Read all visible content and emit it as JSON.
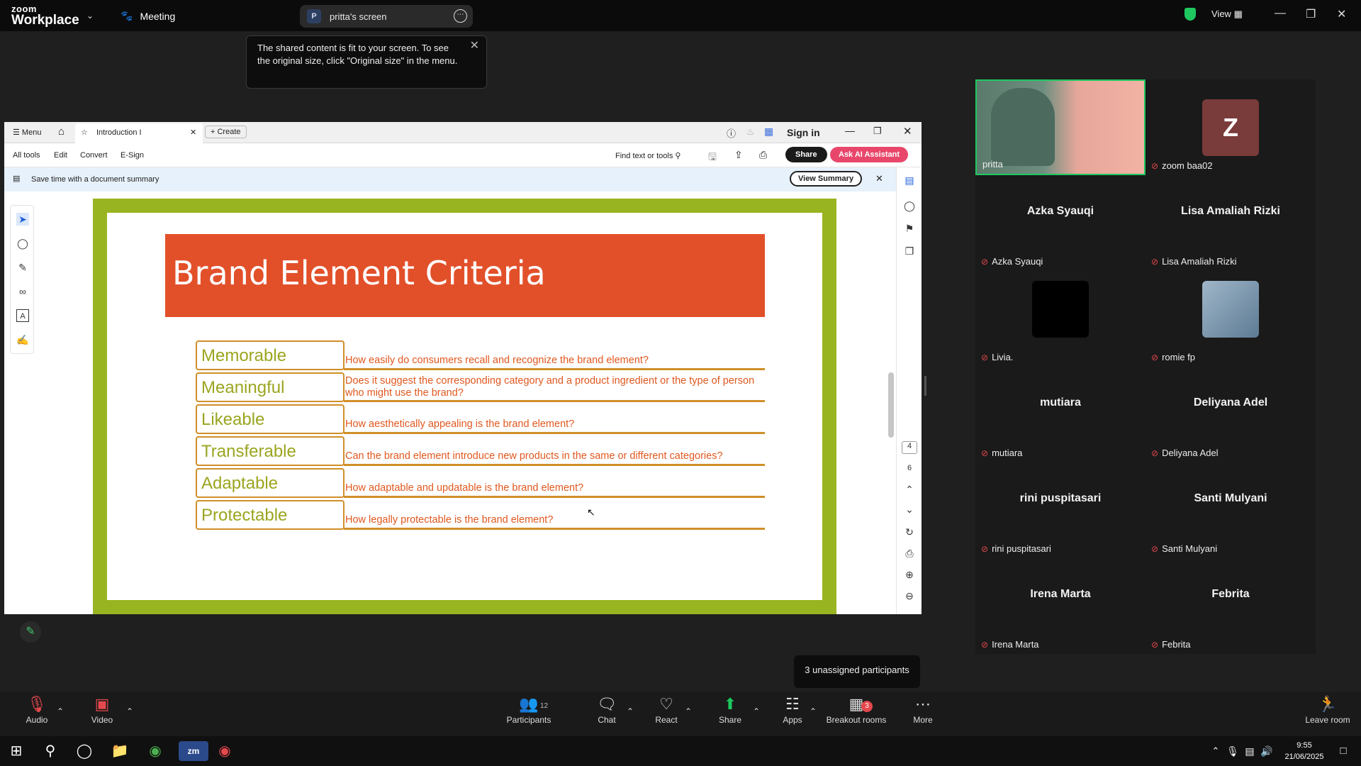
{
  "zoom": {
    "logo_line1": "zoom",
    "logo_line2": "Workplace",
    "meeting_label": "Meeting",
    "share_badge": "P",
    "share_tab": "pritta's screen",
    "view_label": "View",
    "tooltip": "The shared content is fit to your screen. To see the original size, click \"Original size\" in the menu."
  },
  "acrobat": {
    "menu": "Menu",
    "tab_title": "Introduction I",
    "create": "Create",
    "sign_in": "Sign in",
    "tools": [
      "All tools",
      "Edit",
      "Convert",
      "E-Sign"
    ],
    "find": "Find text or tools",
    "share": "Share",
    "ai": "Ask AI Assistant",
    "summary_text": "Save time with a document summary",
    "view_summary": "View Summary",
    "page_current": "4",
    "page_total": "6"
  },
  "slide": {
    "title": "Brand Element Criteria",
    "criteria": [
      {
        "name": "Memorable",
        "question": "How easily do consumers recall and recognize the brand element?"
      },
      {
        "name": "Meaningful",
        "question": "Does it suggest the corresponding category and a product ingredient or the type of person who might use the brand?"
      },
      {
        "name": "Likeable",
        "question": "How aesthetically appealing is the brand element?"
      },
      {
        "name": "Transferable",
        "question": "Can the brand element introduce new products in the same or different categories?"
      },
      {
        "name": "Adaptable",
        "question": "How adaptable and updatable is the brand element?"
      },
      {
        "name": "Protectable",
        "question": "How legally protectable is the brand element?"
      }
    ]
  },
  "participants": [
    {
      "label": "pritta",
      "center": ""
    },
    {
      "label": "zoom baa02",
      "center": "Z"
    },
    {
      "label": "Azka Syauqi",
      "center": "Azka Syauqi"
    },
    {
      "label": "Lisa Amaliah Rizki",
      "center": "Lisa Amaliah Rizki"
    },
    {
      "label": "Livia.",
      "center": ""
    },
    {
      "label": "romie fp",
      "center": ""
    },
    {
      "label": "mutiara",
      "center": "mutiara"
    },
    {
      "label": "Deliyana Adel",
      "center": "Deliyana Adel"
    },
    {
      "label": "rini puspitasari",
      "center": "rini puspitasari"
    },
    {
      "label": "Santi Mulyani",
      "center": "Santi Mulyani"
    },
    {
      "label": "Irena Marta",
      "center": "Irena Marta"
    },
    {
      "label": "Febrita",
      "center": "Febrita"
    }
  ],
  "toolbar": {
    "audio": "Audio",
    "video": "Video",
    "participants": "Participants",
    "participants_count": "12",
    "chat": "Chat",
    "react": "React",
    "share": "Share",
    "apps": "Apps",
    "breakout": "Breakout rooms",
    "breakout_badge": "3",
    "more": "More",
    "leave": "Leave room",
    "unassigned": "3 unassigned participants"
  },
  "taskbar": {
    "time": "9:55",
    "date": "21/06/2025"
  },
  "colors": {
    "slide_border": "#99b421",
    "title_bar": "#e2502a",
    "criteria_border": "#d08f29",
    "question_text": "#e0581f",
    "accent_ai": "#e8476b",
    "share_green": "#1ec85f"
  }
}
